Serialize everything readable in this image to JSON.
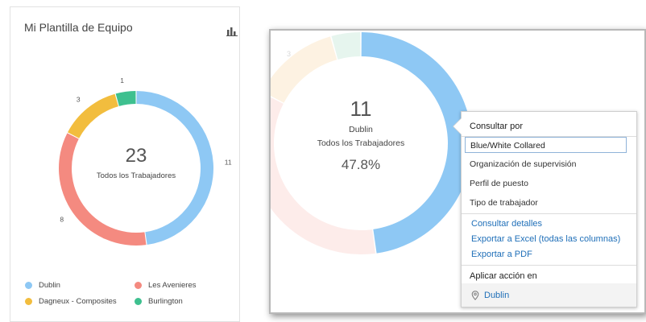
{
  "card": {
    "title": "Mi Plantilla de Equipo",
    "total": "23",
    "total_label": "Todos los Trabajadores",
    "icon": "bar-chart-icon"
  },
  "chart_data": [
    {
      "type": "pie",
      "donut": true,
      "categories": [
        "Dublin",
        "Les Avenieres",
        "Dagneux - Composites",
        "Burlington"
      ],
      "values": [
        11,
        8,
        3,
        1
      ],
      "colors": [
        "#8ec8f4",
        "#f48a80",
        "#f2bd3e",
        "#3ec08f"
      ],
      "value_labels": [
        "11",
        "8",
        "3",
        "1"
      ],
      "center_value": "23",
      "center_label": "Todos los Trabajadores",
      "legend": "bottom"
    },
    {
      "type": "pie",
      "donut": true,
      "categories": [
        "Dublin",
        "Les Avenieres",
        "Dagneux - Composites",
        "Burlington"
      ],
      "values": [
        11,
        8,
        3,
        1
      ],
      "highlight": "Dublin",
      "center_value": "11",
      "center_name": "Dublin",
      "center_label": "Todos los Trabajadores",
      "center_percent": "47.8%"
    }
  ],
  "legend": [
    {
      "label": "Dublin",
      "color": "#8ec8f4"
    },
    {
      "label": "Les Avenieres",
      "color": "#f48a80"
    },
    {
      "label": "Dagneux - Composites",
      "color": "#f2bd3e"
    },
    {
      "label": "Burlington",
      "color": "#3ec08f"
    }
  ],
  "zoom": {
    "value": "11",
    "name": "Dublin",
    "label": "Todos los Trabajadores",
    "percent": "47.8%",
    "faded_label": "3"
  },
  "menu": {
    "consultar_title": "Consultar por",
    "options": [
      "Blue/White Collared",
      "Organización de supervisión",
      "Perfil de puesto",
      "Tipo de trabajador"
    ],
    "links": [
      "Consultar detalles",
      "Exportar a Excel (todas las columnas)",
      "Exportar a PDF"
    ],
    "action_title": "Aplicar acción en",
    "action_target": "Dublin",
    "action_icon": "map-pin-icon"
  }
}
